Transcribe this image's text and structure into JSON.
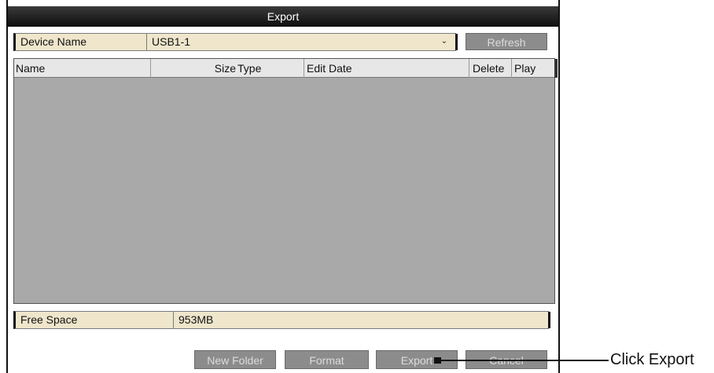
{
  "window": {
    "title": "Export"
  },
  "device": {
    "label": "Device Name",
    "value": "USB1-1",
    "dropdown_icon": "chevron-down-icon"
  },
  "toolbar": {
    "refresh_label": "Refresh"
  },
  "table": {
    "columns": [
      "Name",
      "Size",
      "Type",
      "Edit Date",
      "Delete",
      "Play"
    ],
    "rows": []
  },
  "free_space": {
    "label": "Free Space",
    "value": "953MB"
  },
  "buttons": {
    "new_folder": "New Folder",
    "format": "Format",
    "export": "Export",
    "cancel": "Cancel"
  },
  "annotation": {
    "text": "Click Export"
  },
  "colors": {
    "title_bar": "#111111",
    "field_bg": "#efe6cc",
    "button_bg": "#8c8c8c",
    "table_bg": "#a9a9a9"
  }
}
